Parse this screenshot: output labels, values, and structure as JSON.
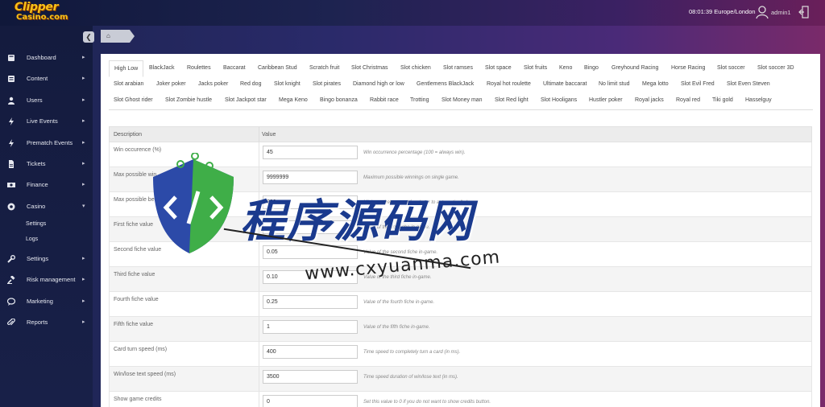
{
  "brand": {
    "line1": "Clipper",
    "line2": "Casino.com"
  },
  "header": {
    "clock": "08:01:39 Europe/London",
    "username": "admin1"
  },
  "sidebar": {
    "items": [
      {
        "label": "Dashboard",
        "icon": "dashboard-icon"
      },
      {
        "label": "Content",
        "icon": "content-icon"
      },
      {
        "label": "Users",
        "icon": "users-icon"
      },
      {
        "label": "Live Events",
        "icon": "bolt-icon"
      },
      {
        "label": "Prematch Events",
        "icon": "bolt-icon"
      },
      {
        "label": "Tickets",
        "icon": "ticket-icon"
      },
      {
        "label": "Finance",
        "icon": "money-icon"
      },
      {
        "label": "Casino",
        "icon": "casino-chip-icon"
      },
      {
        "label": "Settings",
        "icon": "wrench-icon"
      },
      {
        "label": "Risk management",
        "icon": "gavel-icon"
      },
      {
        "label": "Marketing",
        "icon": "chat-icon"
      },
      {
        "label": "Reports",
        "icon": "paperclip-icon"
      }
    ],
    "casino_sub": [
      "Settings",
      "Logs"
    ]
  },
  "tabs": [
    "High Low",
    "BlackJack",
    "Roulettes",
    "Baccarat",
    "Caribbean Stud",
    "Scratch fruit",
    "Slot Christmas",
    "Slot chicken",
    "Slot ramses",
    "Slot space",
    "Slot fruits",
    "Keno",
    "Bingo",
    "Greyhound Racing",
    "Horse Racing",
    "Slot soccer",
    "Slot soccer 3D",
    "Slot arabian",
    "Joker poker",
    "Jacks poker",
    "Red dog",
    "Slot knight",
    "Slot pirates",
    "Diamond high or low",
    "Gentlemens BlackJack",
    "Royal hot roulette",
    "Ultimate baccarat",
    "No limit stud",
    "Mega lotto",
    "Slot Evil Fred",
    "Slot Even Steven",
    "Slot Ghost rider",
    "Slot Zombie hustle",
    "Slot Jackpot star",
    "Mega Keno",
    "Bingo bonanza",
    "Rabbit race",
    "Trotting",
    "Slot Money man",
    "Slot Red light",
    "Slot Hooligans",
    "Hustler poker",
    "Royal jacks",
    "Royal red",
    "Tiki gold",
    "Hasselguy"
  ],
  "active_tab": "High Low",
  "table": {
    "headers": {
      "description": "Description",
      "value": "Value"
    },
    "rows": [
      {
        "desc": "Win occurence (%)",
        "value": "45",
        "help": "Win occurrence percentage (100 = always win)."
      },
      {
        "desc": "Max possible win",
        "value": "9999999",
        "help": "Maximum possible winnings on single game."
      },
      {
        "desc": "Max possible bet",
        "value": "200",
        "help": "Minimum bet amount for player to automatically lose."
      },
      {
        "desc": "First fiche value",
        "value": "",
        "help": "Value of the first fiche in-game."
      },
      {
        "desc": "Second fiche value",
        "value": "0.05",
        "help": "Value of the second fiche in-game."
      },
      {
        "desc": "Third fiche value",
        "value": "0.10",
        "help": "Value of the third fiche in-game."
      },
      {
        "desc": "Fourth fiche value",
        "value": "0.25",
        "help": "Value of the fourth fiche in-game."
      },
      {
        "desc": "Fifth fiche value",
        "value": "1",
        "help": "Value of the fifth fiche in-game."
      },
      {
        "desc": "Card turn speed (ms)",
        "value": "400",
        "help": "Time speed to completely turn a card (in ms)."
      },
      {
        "desc": "Win/lose text speed (ms)",
        "value": "3500",
        "help": "Time speed duration of win/lose text (in ms)."
      },
      {
        "desc": "Show game credits",
        "value": "0",
        "help": "Set this value to 0 if you do not want to show credits button."
      }
    ]
  },
  "watermark": {
    "title": "程序源码网",
    "url": "www.cxyuanma.com"
  },
  "colors": {
    "header_bg": "#1d2350",
    "sidebar_bg": "#141b3e",
    "watermark_blue": "#1a3a8e",
    "watermark_green": "#4caf50"
  }
}
